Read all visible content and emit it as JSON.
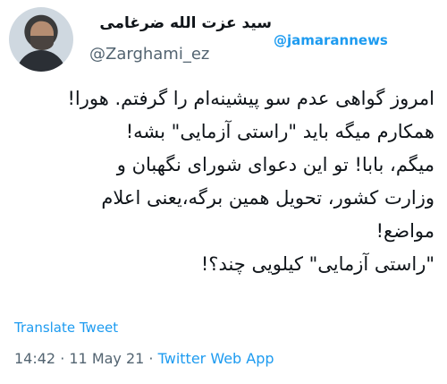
{
  "author": {
    "name": "سید عزت الله ضرغامی",
    "handle": "@Zarghami_ez"
  },
  "watermark": "@jamarannews",
  "tweet": {
    "lines": [
      "امروز گواهی عدم سو پیشینه‌ام را گرفتم. هورا!",
      "همکارم میگه باید \"راستی آزمایی\" بشه!",
      "میگم، بابا! تو این دعوای شورای نگهبان و",
      "وزارت کشور، تحویل همین برگه،یعنی اعلام",
      "مواضع!",
      "\"راستی آزمایی\" کیلویی چند؟!"
    ]
  },
  "translate_label": "Translate Tweet",
  "meta": {
    "time": "14:42",
    "separator1": " · ",
    "date": "11 May 21",
    "separator2": " · ",
    "source": "Twitter Web App"
  }
}
